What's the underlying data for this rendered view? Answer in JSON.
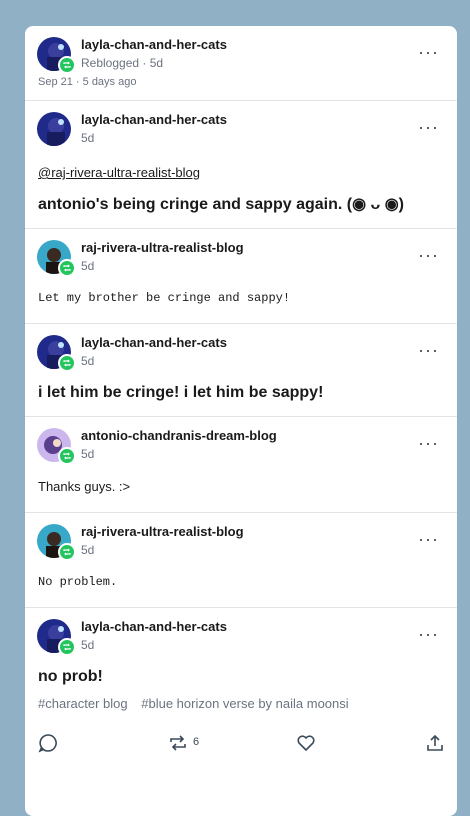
{
  "root": {
    "username": "layla-chan-and-her-cats",
    "status": "Reblogged · 5d",
    "date": "Sep 21 · 5 days ago"
  },
  "posts": [
    {
      "username": "layla-chan-and-her-cats",
      "time": "5d",
      "mention": "@raj-rivera-ultra-realist-blog",
      "text": "antonio's being cringe and sappy again. (◉ ᴗ ◉)"
    },
    {
      "username": "raj-rivera-ultra-realist-blog",
      "time": "5d",
      "text": "Let my brother be cringe and sappy!"
    },
    {
      "username": "layla-chan-and-her-cats",
      "time": "5d",
      "text": "i let him be cringe! i let him be sappy!"
    },
    {
      "username": "antonio-chandranis-dream-blog",
      "time": "5d",
      "text": "Thanks guys. :>"
    },
    {
      "username": "raj-rivera-ultra-realist-blog",
      "time": "5d",
      "text": "No problem."
    },
    {
      "username": "layla-chan-and-her-cats",
      "time": "5d",
      "text": "no prob!"
    }
  ],
  "tags": [
    "#character blog",
    "#blue horizon verse by naila moonsi"
  ],
  "footer": {
    "reblog_count": "6"
  },
  "colors": {
    "background": "#8fb0c5",
    "badge": "#22c55e"
  }
}
